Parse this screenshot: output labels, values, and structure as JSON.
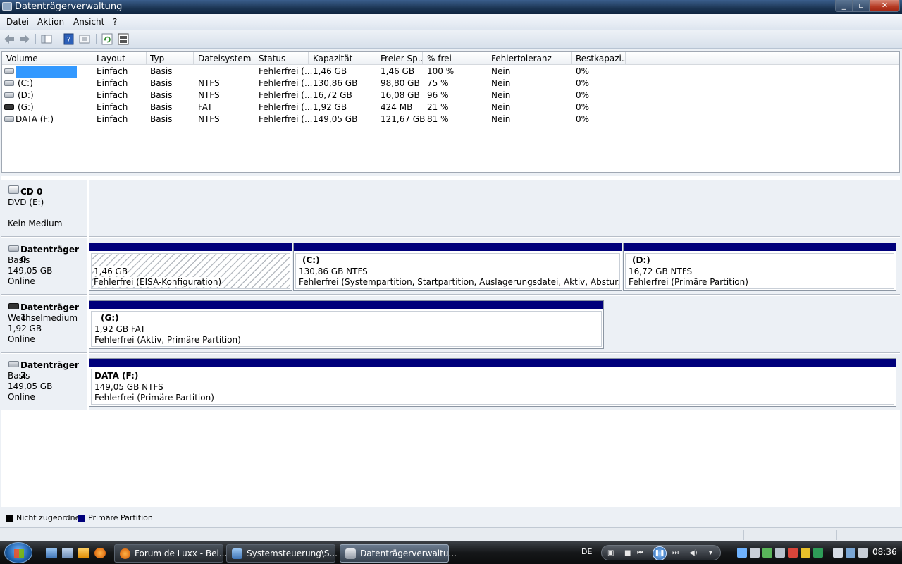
{
  "window": {
    "title": "Datenträgerverwaltung",
    "min": "_",
    "max": "▫",
    "close": "✕"
  },
  "menu": [
    "Datei",
    "Aktion",
    "Ansicht",
    "?"
  ],
  "toolbar": {
    "icons": [
      "back-arrow-icon",
      "forward-arrow-icon",
      "console-tree-icon",
      "help-icon",
      "properties-icon",
      "refresh-icon",
      "rescan-disks-icon"
    ]
  },
  "list": {
    "columns": [
      "Volume",
      "Layout",
      "Typ",
      "Dateisystem",
      "Status",
      "Kapazität",
      "Freier Sp...",
      "% frei",
      "Fehlertoleranz",
      "Restkapazi..."
    ],
    "rows": [
      {
        "volume": "",
        "layout": "Einfach",
        "typ": "Basis",
        "fs": "",
        "status": "Fehlerfrei (...",
        "cap": "1,46 GB",
        "free": "1,46 GB",
        "pct": "100 %",
        "fault": "Nein",
        "overhead": "0%"
      },
      {
        "volume": "(C:)",
        "layout": "Einfach",
        "typ": "Basis",
        "fs": "NTFS",
        "status": "Fehlerfrei (...",
        "cap": "130,86 GB",
        "free": "98,80 GB",
        "pct": "75 %",
        "fault": "Nein",
        "overhead": "0%"
      },
      {
        "volume": "(D:)",
        "layout": "Einfach",
        "typ": "Basis",
        "fs": "NTFS",
        "status": "Fehlerfrei (...",
        "cap": "16,72 GB",
        "free": "16,08 GB",
        "pct": "96 %",
        "fault": "Nein",
        "overhead": "0%"
      },
      {
        "volume": "(G:)",
        "layout": "Einfach",
        "typ": "Basis",
        "fs": "FAT",
        "status": "Fehlerfrei (...",
        "cap": "1,92 GB",
        "free": "424 MB",
        "pct": "21 %",
        "fault": "Nein",
        "overhead": "0%"
      },
      {
        "volume": "DATA (F:)",
        "layout": "Einfach",
        "typ": "Basis",
        "fs": "NTFS",
        "status": "Fehlerfrei (...",
        "cap": "149,05 GB",
        "free": "121,67 GB",
        "pct": "81 %",
        "fault": "Nein",
        "overhead": "0%"
      }
    ]
  },
  "disks": {
    "cd0": {
      "name": "CD 0",
      "line1": "DVD (E:)",
      "line2": "Kein Medium"
    },
    "disk0": {
      "name": "Datenträger 0",
      "type": "Basis",
      "size": "149,05 GB",
      "state": "Online",
      "parts": [
        {
          "name": "",
          "size": "1,46 GB",
          "status": "Fehlerfrei (EISA-Konfiguration)"
        },
        {
          "name": "(C:)",
          "size": "130,86 GB NTFS",
          "status": "Fehlerfrei (Systempartition, Startpartition, Auslagerungsdatei, Aktiv, Absturzabbild, Primäre Partition)"
        },
        {
          "name": "(D:)",
          "size": "16,72 GB NTFS",
          "status": "Fehlerfrei (Primäre Partition)"
        }
      ]
    },
    "disk1": {
      "name": "Datenträger 1",
      "type": "Wechselmedium",
      "size": "1,92 GB",
      "state": "Online",
      "parts": [
        {
          "name": "(G:)",
          "size": "1,92 GB FAT",
          "status": "Fehlerfrei (Aktiv, Primäre Partition)"
        }
      ]
    },
    "disk2": {
      "name": "Datenträger 2",
      "type": "Basis",
      "size": "149,05 GB",
      "state": "Online",
      "parts": [
        {
          "name": "DATA  (F:)",
          "size": "149,05 GB NTFS",
          "status": "Fehlerfrei (Primäre Partition)"
        }
      ]
    }
  },
  "legend": [
    {
      "label": "Nicht zugeordnet",
      "color": "#000000"
    },
    {
      "label": "Primäre Partition",
      "color": "#00007b"
    }
  ],
  "taskbar": {
    "tasks": [
      {
        "label": "Forum de Luxx - Bei..."
      },
      {
        "label": "Systemsteuerung\\S..."
      },
      {
        "label": "Datenträgerverwaltu..."
      }
    ],
    "lang": "DE",
    "clock": "08:36"
  }
}
